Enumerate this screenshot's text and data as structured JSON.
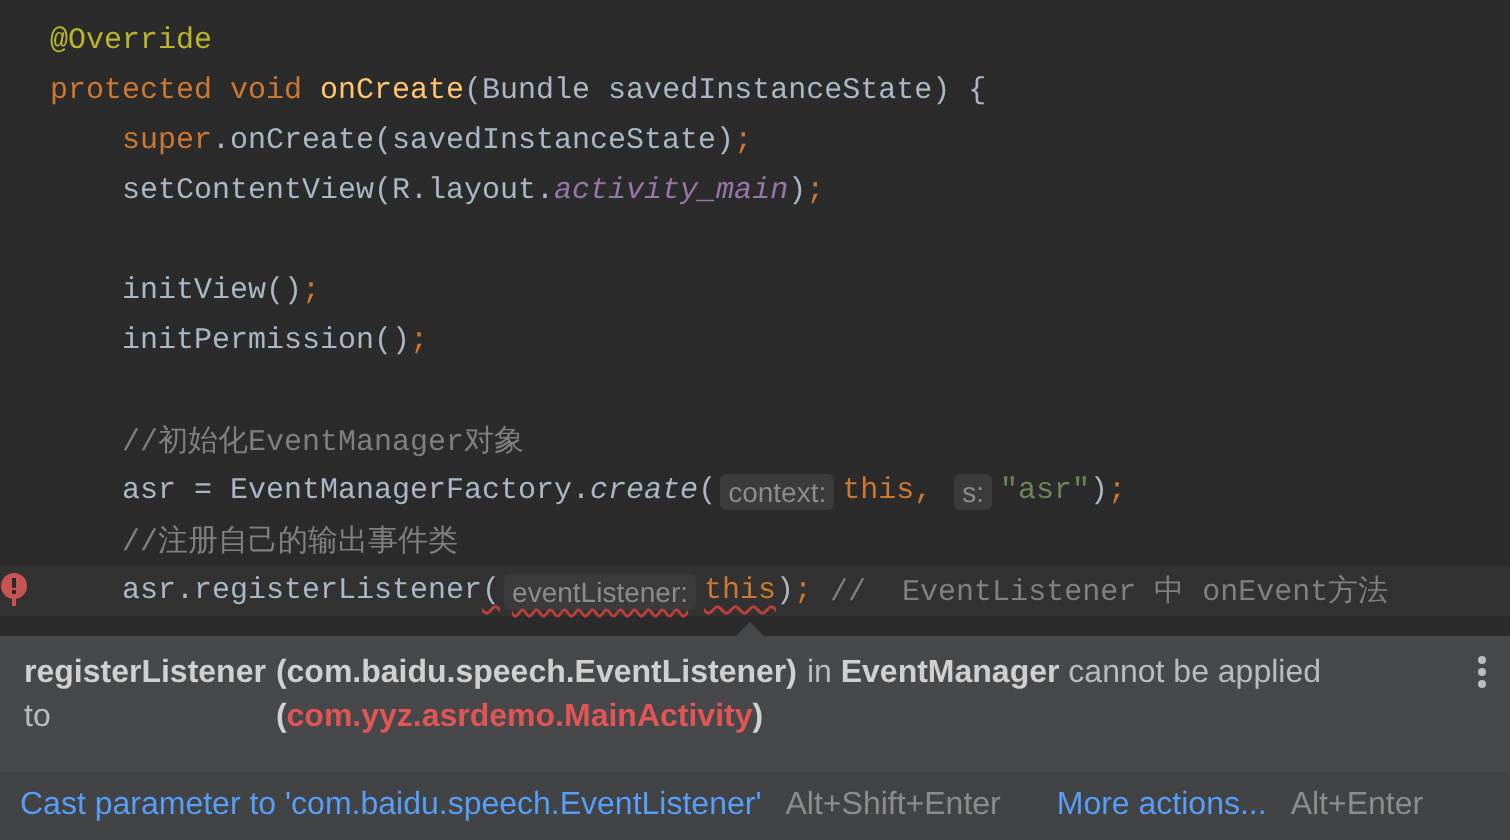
{
  "editor": {
    "lines": [
      {
        "kind": "code",
        "tokens": [
          {
            "text": "@Override",
            "kind": "annotation"
          }
        ]
      },
      {
        "kind": "code",
        "tokens": [
          {
            "text": "protected void ",
            "kind": "keyword"
          },
          {
            "text": "onCreate",
            "kind": "method"
          },
          {
            "text": "(Bundle savedInstanceState) {",
            "kind": "plain"
          }
        ],
        "children": [
          {
            "kind": "code",
            "tokens": [
              {
                "text": "super",
                "kind": "keyword"
              },
              {
                "text": ".onCreate(savedInstanceState)",
                "kind": "plain"
              },
              {
                "text": ";",
                "kind": "keyword"
              }
            ]
          },
          {
            "kind": "code",
            "tokens": [
              {
                "text": "setContentView(R.layout.",
                "kind": "plain"
              },
              {
                "text": "activity_main",
                "kind": "field"
              },
              {
                "text": ")",
                "kind": "plain"
              },
              {
                "text": ";",
                "kind": "keyword"
              }
            ]
          },
          {
            "kind": "blank"
          },
          {
            "kind": "code",
            "tokens": [
              {
                "text": "initView()",
                "kind": "plain"
              },
              {
                "text": ";",
                "kind": "keyword"
              }
            ]
          },
          {
            "kind": "code",
            "tokens": [
              {
                "text": "initPermission()",
                "kind": "plain"
              },
              {
                "text": ";",
                "kind": "keyword"
              }
            ]
          },
          {
            "kind": "blank"
          },
          {
            "kind": "code",
            "tokens": [
              {
                "text": "//初始化EventManager对象",
                "kind": "comment"
              }
            ]
          },
          {
            "kind": "code",
            "tokens": [
              {
                "text": "asr = EventManagerFactory.",
                "kind": "plain"
              },
              {
                "text": "create",
                "kind": "static"
              },
              {
                "text": "(",
                "kind": "plain"
              },
              {
                "text": "context:",
                "kind": "hint"
              },
              {
                "text": "this, ",
                "kind": "keyword"
              },
              {
                "text": "s:",
                "kind": "hint"
              },
              {
                "text": "\"asr\"",
                "kind": "string"
              },
              {
                "text": ")",
                "kind": "plain"
              },
              {
                "text": ";",
                "kind": "keyword"
              }
            ]
          },
          {
            "kind": "code",
            "tokens": [
              {
                "text": "//注册自己的输出事件类",
                "kind": "comment"
              }
            ]
          },
          {
            "kind": "code",
            "error": true,
            "current": true,
            "tokens": [
              {
                "text": "asr.registerListener",
                "kind": "plain"
              },
              {
                "text": "(",
                "kind": "plain",
                "error": true
              },
              {
                "text": "eventListener:",
                "kind": "hint",
                "error": true
              },
              {
                "text": "this",
                "kind": "keyword",
                "error": true
              },
              {
                "text": ")",
                "kind": "plain"
              },
              {
                "text": "; ",
                "kind": "keyword"
              },
              {
                "text": "//  EventListener 中 onEvent方法",
                "kind": "comment"
              }
            ]
          }
        ]
      }
    ]
  },
  "popup": {
    "method": "registerListener",
    "expected": "(com.baidu.speech.EventListener)",
    "rest": "in **EventManager** cannot be applied",
    "to": "to",
    "actual": "(com.yyz.asrdemo.MainActivity)",
    "actions": [
      {
        "kind": "fix",
        "label": "Cast parameter to 'com.baidu.speech.EventListener'",
        "shortcut": "Alt+Shift+Enter"
      },
      {
        "kind": "more",
        "label": "More actions...",
        "shortcut": "Alt+Enter"
      }
    ]
  }
}
